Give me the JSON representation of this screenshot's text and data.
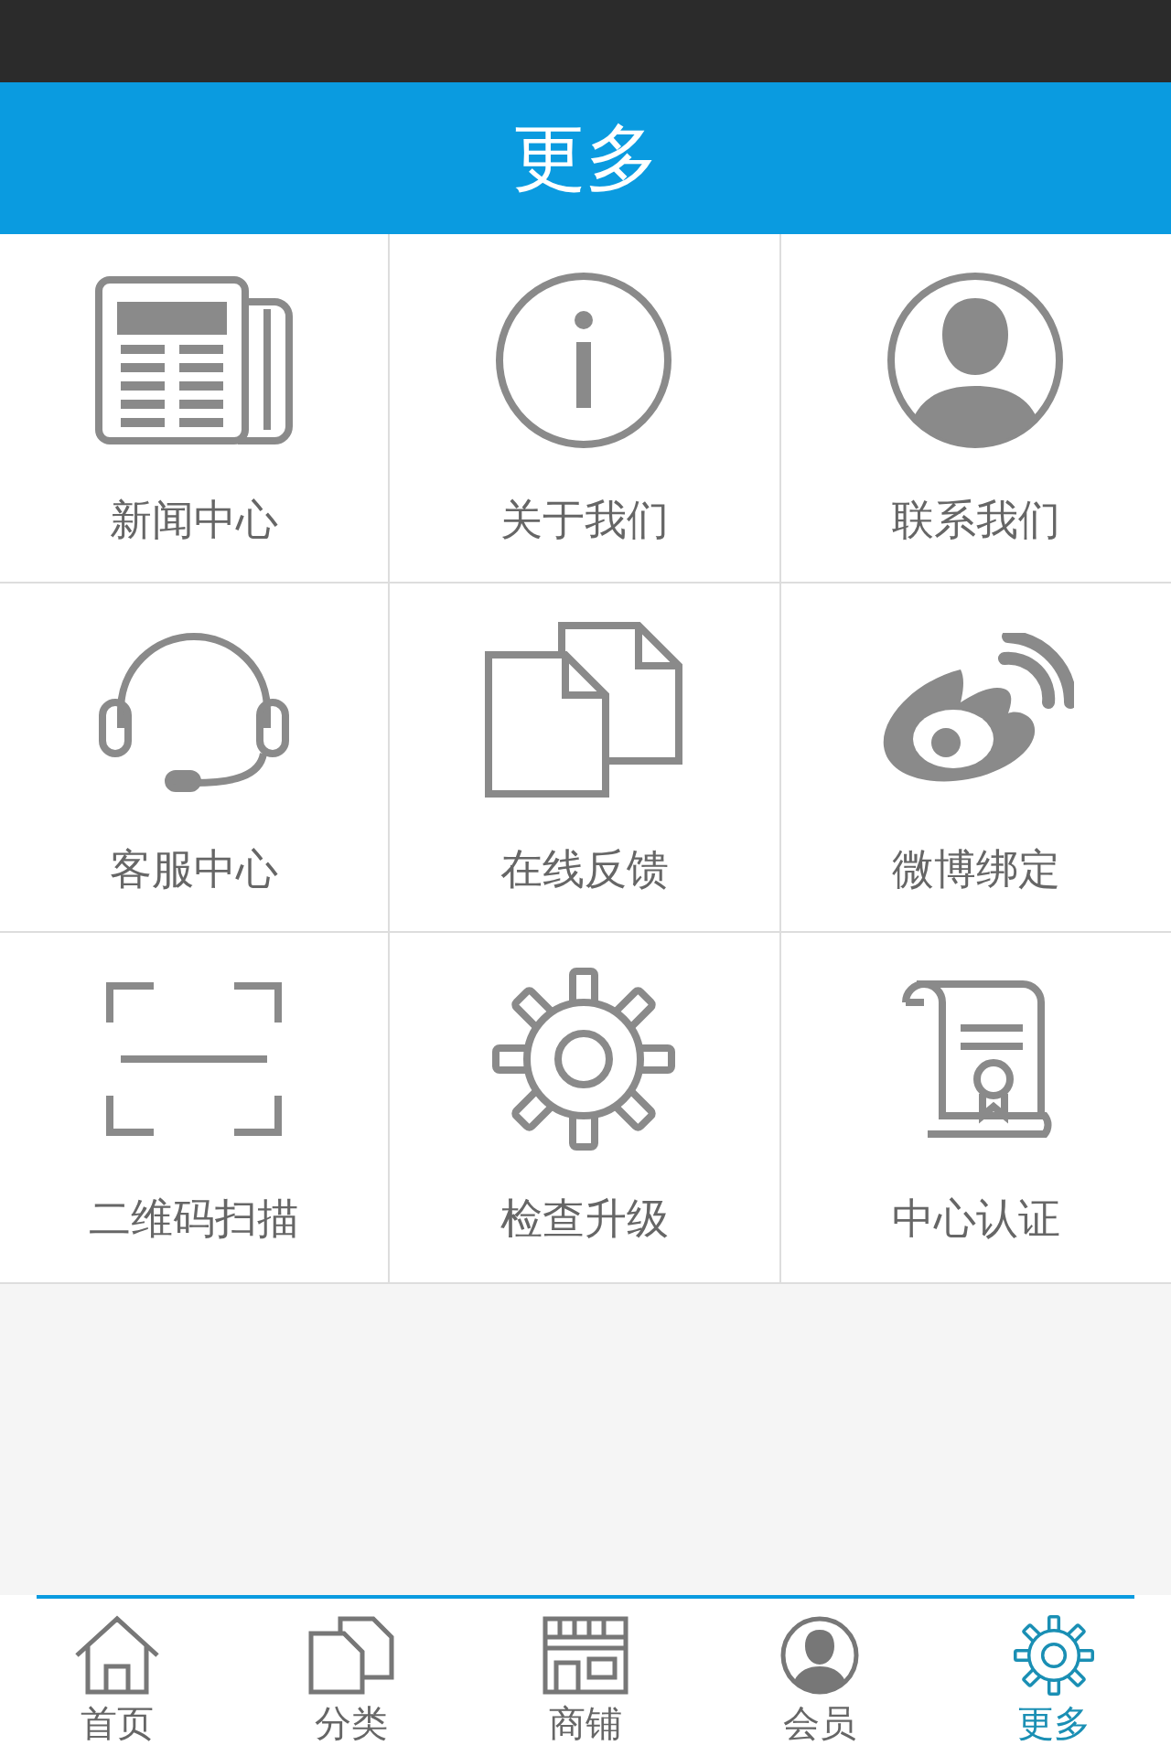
{
  "header": {
    "title": "更多"
  },
  "grid": [
    {
      "kind": "news",
      "label": "新闻中心"
    },
    {
      "kind": "info",
      "label": "关于我们"
    },
    {
      "kind": "contact",
      "label": "联系我们"
    },
    {
      "kind": "headset",
      "label": "客服中心"
    },
    {
      "kind": "documents",
      "label": "在线反馈"
    },
    {
      "kind": "weibo",
      "label": "微博绑定"
    },
    {
      "kind": "scan",
      "label": "二维码扫描"
    },
    {
      "kind": "gear",
      "label": "检查升级"
    },
    {
      "kind": "certificate",
      "label": "中心认证"
    }
  ],
  "tab_bar": [
    {
      "kind": "home",
      "label": "首页",
      "selected": false
    },
    {
      "kind": "category",
      "label": "分类",
      "selected": false
    },
    {
      "kind": "shop",
      "label": "商铺",
      "selected": false
    },
    {
      "kind": "member",
      "label": "会员",
      "selected": false
    },
    {
      "kind": "gear",
      "label": "更多",
      "selected": true
    }
  ]
}
